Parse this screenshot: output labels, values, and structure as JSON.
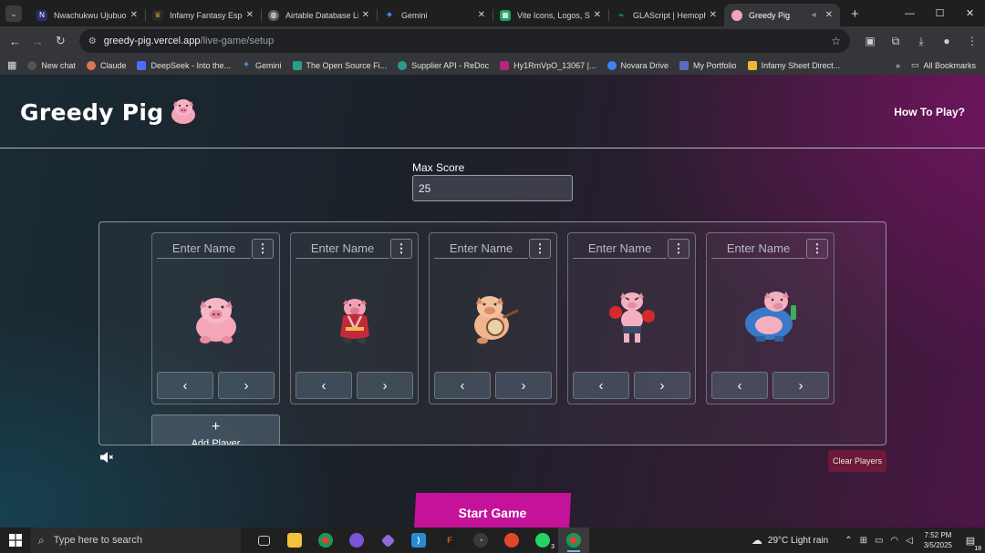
{
  "browser": {
    "tabs": [
      {
        "title": "Nwachukwu Ujubuonu",
        "icon": "ni-icon",
        "color": "#2b2f6b"
      },
      {
        "title": "Infamy Fantasy Esports",
        "icon": "crown-icon",
        "color": "#c9a227"
      },
      {
        "title": "Airtable Database Link",
        "icon": "globe-icon",
        "color": "#5f6368"
      },
      {
        "title": "Gemini",
        "icon": "gemini-icon",
        "color": "#4a8af4"
      },
      {
        "title": "Vite Icons, Logos, Symbols",
        "icon": "sheet-icon",
        "color": "#1ea362"
      },
      {
        "title": "GLAScript | Hemophilia",
        "icon": "glascript-icon",
        "color": "#2a9d8f"
      },
      {
        "title": "Greedy Pig",
        "icon": "pig-icon",
        "color": "#f2a5b8",
        "active": true
      }
    ],
    "url_host": "greedy-pig.vercel.app",
    "url_path": "/live-game/setup",
    "bookmarks": [
      {
        "label": "New chat",
        "color": "#555555"
      },
      {
        "label": "Claude",
        "color": "#d97757"
      },
      {
        "label": "DeepSeek - Into the...",
        "color": "#4d6bfe"
      },
      {
        "label": "Gemini",
        "color": "#4a8af4"
      },
      {
        "label": "The Open Source Fi...",
        "color": "#2a9d8f"
      },
      {
        "label": "Supplier API - ReDoc",
        "color": "#2a9d8f"
      },
      {
        "label": "Hy1RmVpO_13067 |...",
        "color": "#b4277e"
      },
      {
        "label": "Novara Drive",
        "color": "#3b82f6"
      },
      {
        "label": "My Portfolio",
        "color": "#5c6bc0"
      },
      {
        "label": "Infamy Sheet Direct...",
        "color": "#f2b632"
      }
    ],
    "all_bookmarks": "All Bookmarks"
  },
  "app": {
    "title": "Greedy Pig",
    "how_to_play": "How To Play?",
    "max_score_label": "Max Score",
    "max_score_value": "25",
    "name_placeholder": "Enter Name",
    "menu_glyph": "⋮",
    "prev_glyph": "‹",
    "next_glyph": "›",
    "players": [
      {
        "avatar": "pig-sitting",
        "name": ""
      },
      {
        "avatar": "pig-kimono",
        "name": ""
      },
      {
        "avatar": "pig-banjo",
        "name": ""
      },
      {
        "avatar": "pig-boxer",
        "name": ""
      },
      {
        "avatar": "pig-drinking",
        "name": ""
      }
    ],
    "add_player_plus": "+",
    "add_player_label": "Add Player",
    "clear_players": "Clear Players",
    "start_game": "Start Game",
    "colors": {
      "accent": "#c4129a",
      "danger": "#6b1a3a"
    }
  },
  "taskbar": {
    "search_placeholder": "Type here to search",
    "weather_temp": "29°C",
    "weather_desc": "Light rain",
    "time": "7:52 PM",
    "date": "3/5/2025",
    "whatsapp_badge": "3",
    "notification_count": "18"
  }
}
